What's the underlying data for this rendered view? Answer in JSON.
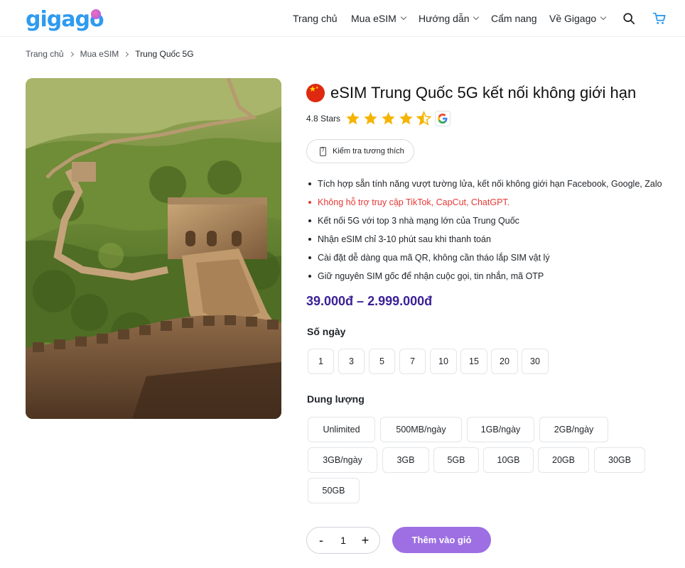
{
  "brand": {
    "logo_text": "gigago"
  },
  "nav": {
    "items": [
      {
        "label": "Trang chủ",
        "dropdown": false
      },
      {
        "label": "Mua eSIM",
        "dropdown": true
      },
      {
        "label": "Hướng dẫn",
        "dropdown": true
      },
      {
        "label": "Cẩm nang",
        "dropdown": false
      },
      {
        "label": "Về Gigago",
        "dropdown": true
      }
    ],
    "icons": [
      "search-icon",
      "cart-icon"
    ]
  },
  "breadcrumb": [
    "Trang chủ",
    "Mua eSIM",
    "Trung Quốc 5G"
  ],
  "product": {
    "title": "eSIM Trung Quốc 5G kết nối không giới hạn",
    "flag": "china-flag",
    "rating_text": "4.8 Stars",
    "rating_value": 4.5,
    "rating_max": 5,
    "rating_source": "google-icon",
    "compat_button": "Kiểm tra tương thích",
    "features": [
      "Tích hợp sẵn tính năng vượt tường lửa, kết nối không giới hạn Facebook, Google, Zalo",
      "Không hỗ trợ truy cập TikTok, CapCut, ChatGPT.",
      "Kết nối 5G với top 3 nhà mạng lớn của Trung Quốc",
      "Nhận eSIM chỉ 3-10 phút sau khi thanh toán",
      "Cài đặt dễ dàng qua mã QR, không cần tháo lắp SIM vật lý",
      "Giữ nguyên SIM gốc để nhận cuộc gọi, tin nhắn, mã OTP"
    ],
    "price": "39.000đ – 2.999.000đ"
  },
  "days": {
    "label": "Số ngày",
    "options": [
      "1",
      "3",
      "5",
      "7",
      "10",
      "15",
      "20",
      "30"
    ]
  },
  "data_plan": {
    "label": "Dung lượng",
    "options": [
      "Unlimited",
      "500MB/ngày",
      "1GB/ngày",
      "2GB/ngày",
      "3GB/ngày",
      "3GB",
      "5GB",
      "10GB",
      "20GB",
      "30GB",
      "50GB"
    ]
  },
  "cart": {
    "minus": "-",
    "quantity": "1",
    "plus": "+",
    "add_label": "Thêm vào giỏ"
  },
  "colors": {
    "brand_blue": "#2f9bf0",
    "price": "#3b2196",
    "warning": "#e53935",
    "add_button": "#9d6fe3",
    "star": "#f5b400"
  }
}
